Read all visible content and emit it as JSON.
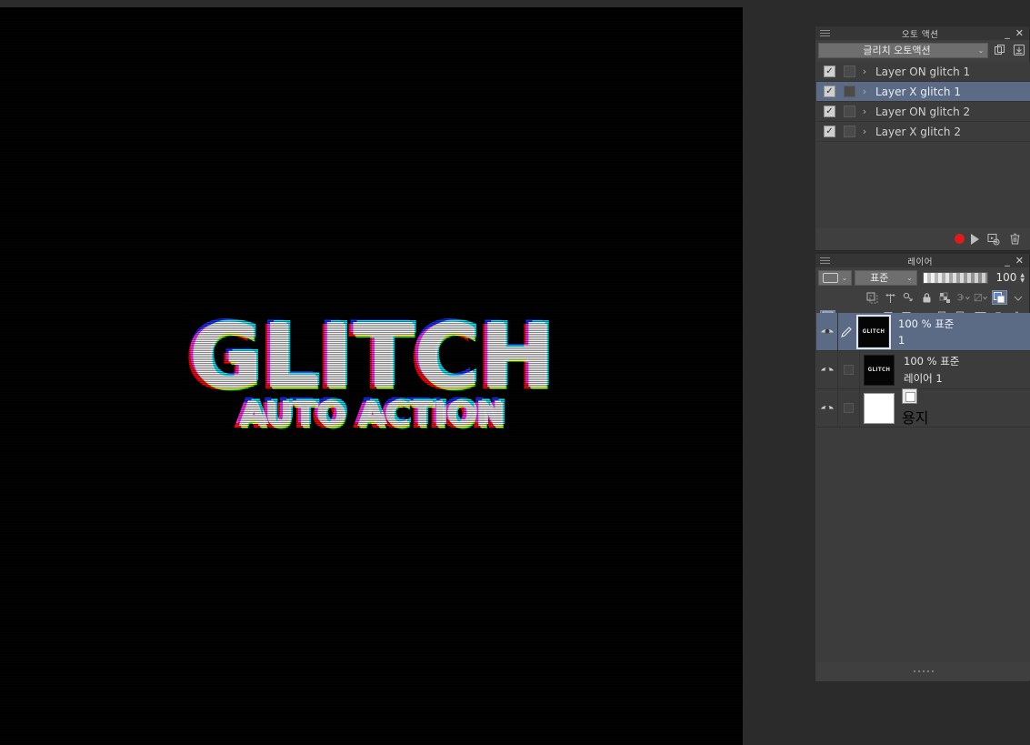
{
  "app": {
    "canvas_background": "#000000",
    "ui_background": "#2b2b2b",
    "panel_background": "#3f3f3f",
    "selection_color": "#5b6b85"
  },
  "artwork": {
    "title_text": "GLITCH",
    "subtitle_text": "AUTO ACTION",
    "effect": "rgb-chromatic-aberration-glitch",
    "colors": {
      "red": "#ff0000",
      "cyan": "#00e5ff",
      "blue": "#1a2bff",
      "green": "#00ff44",
      "yellow": "#ffee00",
      "white": "#f2f2f2"
    }
  },
  "auto_action_panel": {
    "title": "오토 액션",
    "minimize_label": "_",
    "close_label": "✕",
    "menu_icon": "hamburger-menu-icon",
    "set_selector": {
      "value": "글리치 오토액션",
      "chevron": "⌄"
    },
    "toolbar_icons": [
      "copy-set-icon",
      "import-set-icon"
    ],
    "actions": [
      {
        "label": "Layer ON glitch 1",
        "checked": true,
        "selected": false
      },
      {
        "label": "Layer X glitch 1",
        "checked": true,
        "selected": true
      },
      {
        "label": "Layer ON glitch 2",
        "checked": true,
        "selected": false
      },
      {
        "label": "Layer X glitch 2",
        "checked": true,
        "selected": false
      }
    ],
    "check_glyph": "✓",
    "expand_glyph": "›",
    "bottom_buttons": [
      {
        "name": "record-button",
        "icon": "record-circle-icon"
      },
      {
        "name": "play-button",
        "icon": "play-triangle-icon"
      },
      {
        "name": "add-action-button",
        "icon": "add-action-icon"
      },
      {
        "name": "delete-action-button",
        "icon": "trash-icon"
      }
    ]
  },
  "layer_panel": {
    "title": "레이어",
    "minimize_label": "_",
    "close_label": "✕",
    "menu_icon": "hamburger-menu-icon",
    "mask_selector": {
      "value": "",
      "chevron": "⌄"
    },
    "blend_mode": {
      "value": "표준",
      "chevron": "⌄"
    },
    "opacity": {
      "value": "100",
      "up": "▲",
      "down": "▼"
    },
    "tool_row_icons": [
      "clip-to-layer-icon",
      "ruler-icon",
      "effect-icon",
      "lock-icon",
      "lock-transparency-icon",
      "select-layer-icon",
      "mask-icon",
      "color-swatch-icon"
    ],
    "action_row_icons": [
      "layer-list-icon",
      "new-raster-layer-icon",
      "new-tone-layer-icon",
      "new-folder-icon",
      "transfer-down-icon",
      "combine-down-icon",
      "layer-mask-icon",
      "layer-property-icon",
      "delete-layer-icon"
    ],
    "layers": [
      {
        "blend_info": "100 % 표준",
        "name": "1",
        "thumbnail_text": "GLITCH",
        "thumbnail_type": "art",
        "visible": true,
        "selected": true,
        "has_pencil": true
      },
      {
        "blend_info": "100 % 표준",
        "name": "레이어 1",
        "thumbnail_text": "GLITCH",
        "thumbnail_type": "art",
        "visible": true,
        "selected": false,
        "has_pencil": false
      },
      {
        "blend_info": "",
        "name": "용지",
        "thumbnail_text": "",
        "thumbnail_type": "paper",
        "visible": true,
        "selected": false,
        "has_pencil": false
      }
    ]
  }
}
